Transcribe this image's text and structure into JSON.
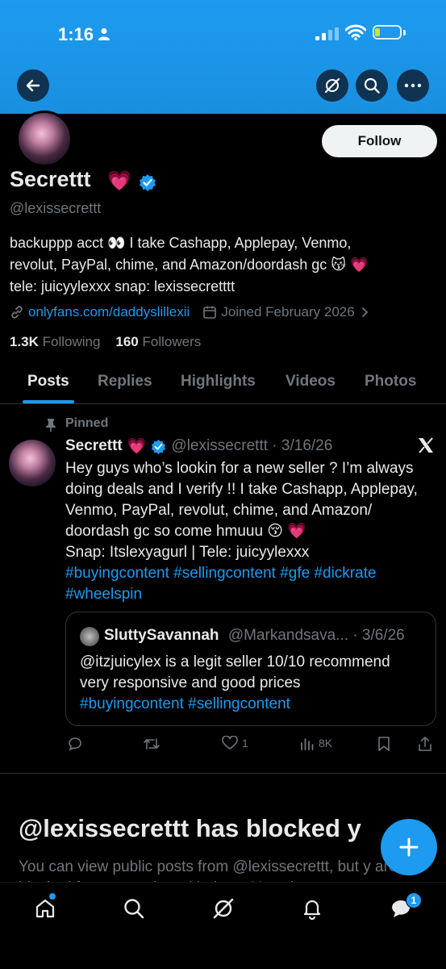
{
  "status_bar": {
    "time": "1:16"
  },
  "profile": {
    "display_name": "Secrettt",
    "name_emoji": "💗",
    "handle": "@lexissecrettt",
    "follow_label": "Follow",
    "bio_line1": "backuppp acct 👀 I take Cashapp, Applepay, Venmo,",
    "bio_line2": "revolut, PayPal, chime, and Amazon/doordash gc 😽 💗",
    "bio_line3": "tele: juicyylexxx snap: lexissecretttt",
    "link": "onlyfans.com/daddyslillexii",
    "joined": "Joined February 2026",
    "following_count": "1.3K",
    "following_label": "Following",
    "followers_count": "160",
    "followers_label": "Followers"
  },
  "tabs": [
    "Posts",
    "Replies",
    "Highlights",
    "Videos",
    "Photos"
  ],
  "post": {
    "pinned_label": "Pinned",
    "author_name": "Secrettt",
    "author_emoji": "💗",
    "author_handle_date": "@lexissecrettt · 3/16/26",
    "line1": "Hey guys who’s lookin for a new seller ? I’m always",
    "line2": "doing deals and I verify !! I take Cashapp, Applepay,",
    "line3": "Venmo, PayPal, revolut, chime, and Amazon/",
    "line4": "doordash gc so come hmuuu 😚 💗",
    "line5": "Snap: Itslexyagurl | Tele: juicyylexxx",
    "hashtags_line1": "#buyingcontent #sellingcontent #gfe #dickrate",
    "hashtags_line2": "#wheelspin",
    "quote": {
      "name": "SluttySavannah",
      "handle_date": "@Markandsava... · 3/6/26",
      "line1": "@itzjuicylex  is a legit seller 10/10 recommend",
      "line2": "very responsive and good prices",
      "hashtags": "#buyingcontent #sellingcontent"
    },
    "likes": "1",
    "views": "8K"
  },
  "blocked": {
    "title": "@lexissecrettt has blocked y",
    "text": "You can view public posts from @lexissecrettt, but y are blocked from engaging with them. You also cannot"
  },
  "nav": {
    "messages_badge": "1"
  },
  "colors": {
    "accent": "#1d9bf0",
    "pink": "#f91880",
    "muted": "#71767b",
    "banner": "#1d9bf0"
  }
}
